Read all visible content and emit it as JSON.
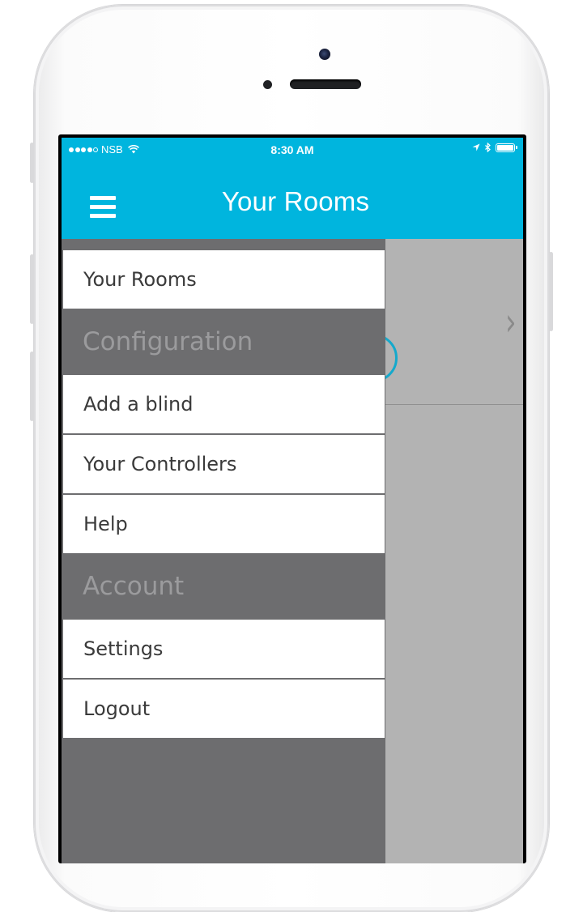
{
  "status_bar": {
    "signal_filled": 4,
    "signal_total": 5,
    "carrier": "NSB",
    "time": "8:30 AM"
  },
  "header": {
    "title": "Your Rooms",
    "menu_icon": "hamburger-menu-icon",
    "background_color": "#00b5de"
  },
  "drawer": {
    "items": [
      {
        "type": "item",
        "label": "Your Rooms"
      },
      {
        "type": "header",
        "label": "Configuration"
      },
      {
        "type": "item",
        "label": "Add a blind"
      },
      {
        "type": "item",
        "label": "Your Controllers"
      },
      {
        "type": "item",
        "label": "Help"
      },
      {
        "type": "header",
        "label": "Account"
      },
      {
        "type": "item",
        "label": "Settings"
      },
      {
        "type": "item",
        "label": "Logout"
      }
    ],
    "background_color": "#6d6d6f"
  },
  "background_content": {
    "chevron_icon": "chevron-right-icon"
  }
}
